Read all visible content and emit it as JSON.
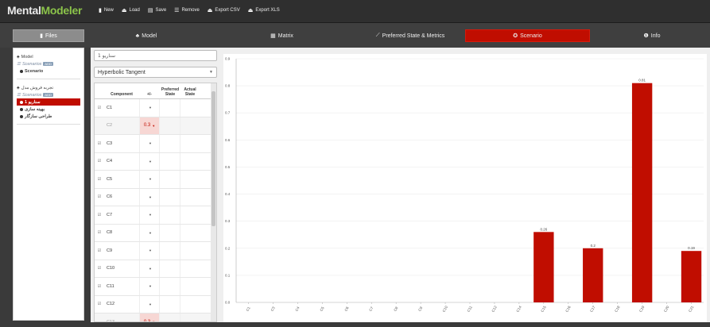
{
  "app": {
    "logo_part1": "Mental",
    "logo_part2": "Modeler"
  },
  "menu": [
    {
      "icon": "new-icon",
      "glyph": "▮",
      "label": "New"
    },
    {
      "icon": "load-icon",
      "glyph": "⏏",
      "label": "Load"
    },
    {
      "icon": "save-icon",
      "glyph": "▤",
      "label": "Save"
    },
    {
      "icon": "remove-icon",
      "glyph": "☰",
      "label": "Remove"
    },
    {
      "icon": "export-csv-icon",
      "glyph": "⏏",
      "label": "Export CSV"
    },
    {
      "icon": "export-xls-icon",
      "glyph": "⏏",
      "label": "Export XLS"
    }
  ],
  "tabs": [
    {
      "label": "Files",
      "glyph": "▮",
      "icon": "file-icon"
    },
    {
      "label": "Model",
      "glyph": "♣",
      "icon": "model-icon"
    },
    {
      "label": "Matrix",
      "glyph": "▦",
      "icon": "matrix-icon"
    },
    {
      "label": "Preferred State & Metrics",
      "glyph": "⟋",
      "icon": "chart-line-icon"
    },
    {
      "label": "Scenario",
      "glyph": "✪",
      "icon": "scenario-icon"
    },
    {
      "label": "Info",
      "glyph": "❶",
      "icon": "info-icon"
    }
  ],
  "active_tab": "Scenario",
  "colors": {
    "accent": "#c00d00",
    "bar": "#c00d00",
    "logo_green": "#8bc34a"
  },
  "sidebar": {
    "groups": [
      {
        "title": "Model",
        "scenarios_label": "Scenarios",
        "add_label": "ADD",
        "items": [
          {
            "label": "Scenario",
            "selected": false
          }
        ]
      },
      {
        "title": "تجربه فروش مدل",
        "scenarios_label": "Scenarios",
        "add_label": "ADD",
        "items": [
          {
            "label": "سناریو 1",
            "selected": true
          },
          {
            "label": "بهینه سازی",
            "selected": false
          },
          {
            "label": "طراحی سازگار",
            "selected": false
          }
        ]
      }
    ]
  },
  "scenario": {
    "name_value": "سناریو 1",
    "function_value": "Hyperbolic Tangent"
  },
  "table": {
    "headers": {
      "component": "Component",
      "pm": "+/-",
      "preferred": "Preferred State",
      "actual": "Actual State"
    },
    "rows": [
      {
        "checked": true,
        "name": "C1",
        "value": ""
      },
      {
        "checked": false,
        "name": "C2",
        "value": "0.3"
      },
      {
        "checked": true,
        "name": "C3",
        "value": ""
      },
      {
        "checked": true,
        "name": "C4",
        "value": ""
      },
      {
        "checked": true,
        "name": "C5",
        "value": ""
      },
      {
        "checked": true,
        "name": "C6",
        "value": ""
      },
      {
        "checked": true,
        "name": "C7",
        "value": ""
      },
      {
        "checked": true,
        "name": "C8",
        "value": ""
      },
      {
        "checked": true,
        "name": "C9",
        "value": ""
      },
      {
        "checked": true,
        "name": "C10",
        "value": ""
      },
      {
        "checked": true,
        "name": "C11",
        "value": ""
      },
      {
        "checked": true,
        "name": "C12",
        "value": ""
      },
      {
        "checked": false,
        "name": "C13",
        "value": "0.3"
      }
    ]
  },
  "chart_data": {
    "type": "bar",
    "categories": [
      "C1",
      "C3",
      "C4",
      "C5",
      "C6",
      "C7",
      "C8",
      "C9",
      "C10",
      "C11",
      "C12",
      "C14",
      "C15",
      "C16",
      "C17",
      "C18",
      "C19",
      "C20",
      "C21"
    ],
    "values": [
      0,
      0,
      0,
      0,
      0,
      0,
      0,
      0,
      0,
      0,
      0,
      0,
      0.26,
      0,
      0.2,
      0,
      0.81,
      0,
      0.19
    ],
    "labels": [
      "",
      "",
      "",
      "",
      "",
      "",
      "",
      "",
      "",
      "",
      "",
      "",
      "0.26",
      "",
      "0.2",
      "",
      "0.81",
      "",
      "0.19"
    ],
    "yticks": [
      "0.0",
      "0.1",
      "0.2",
      "0.3",
      "0.4",
      "0.5",
      "0.6",
      "0.7",
      "0.8",
      "0.9"
    ],
    "ylim": [
      0,
      0.9
    ],
    "grid": true
  }
}
